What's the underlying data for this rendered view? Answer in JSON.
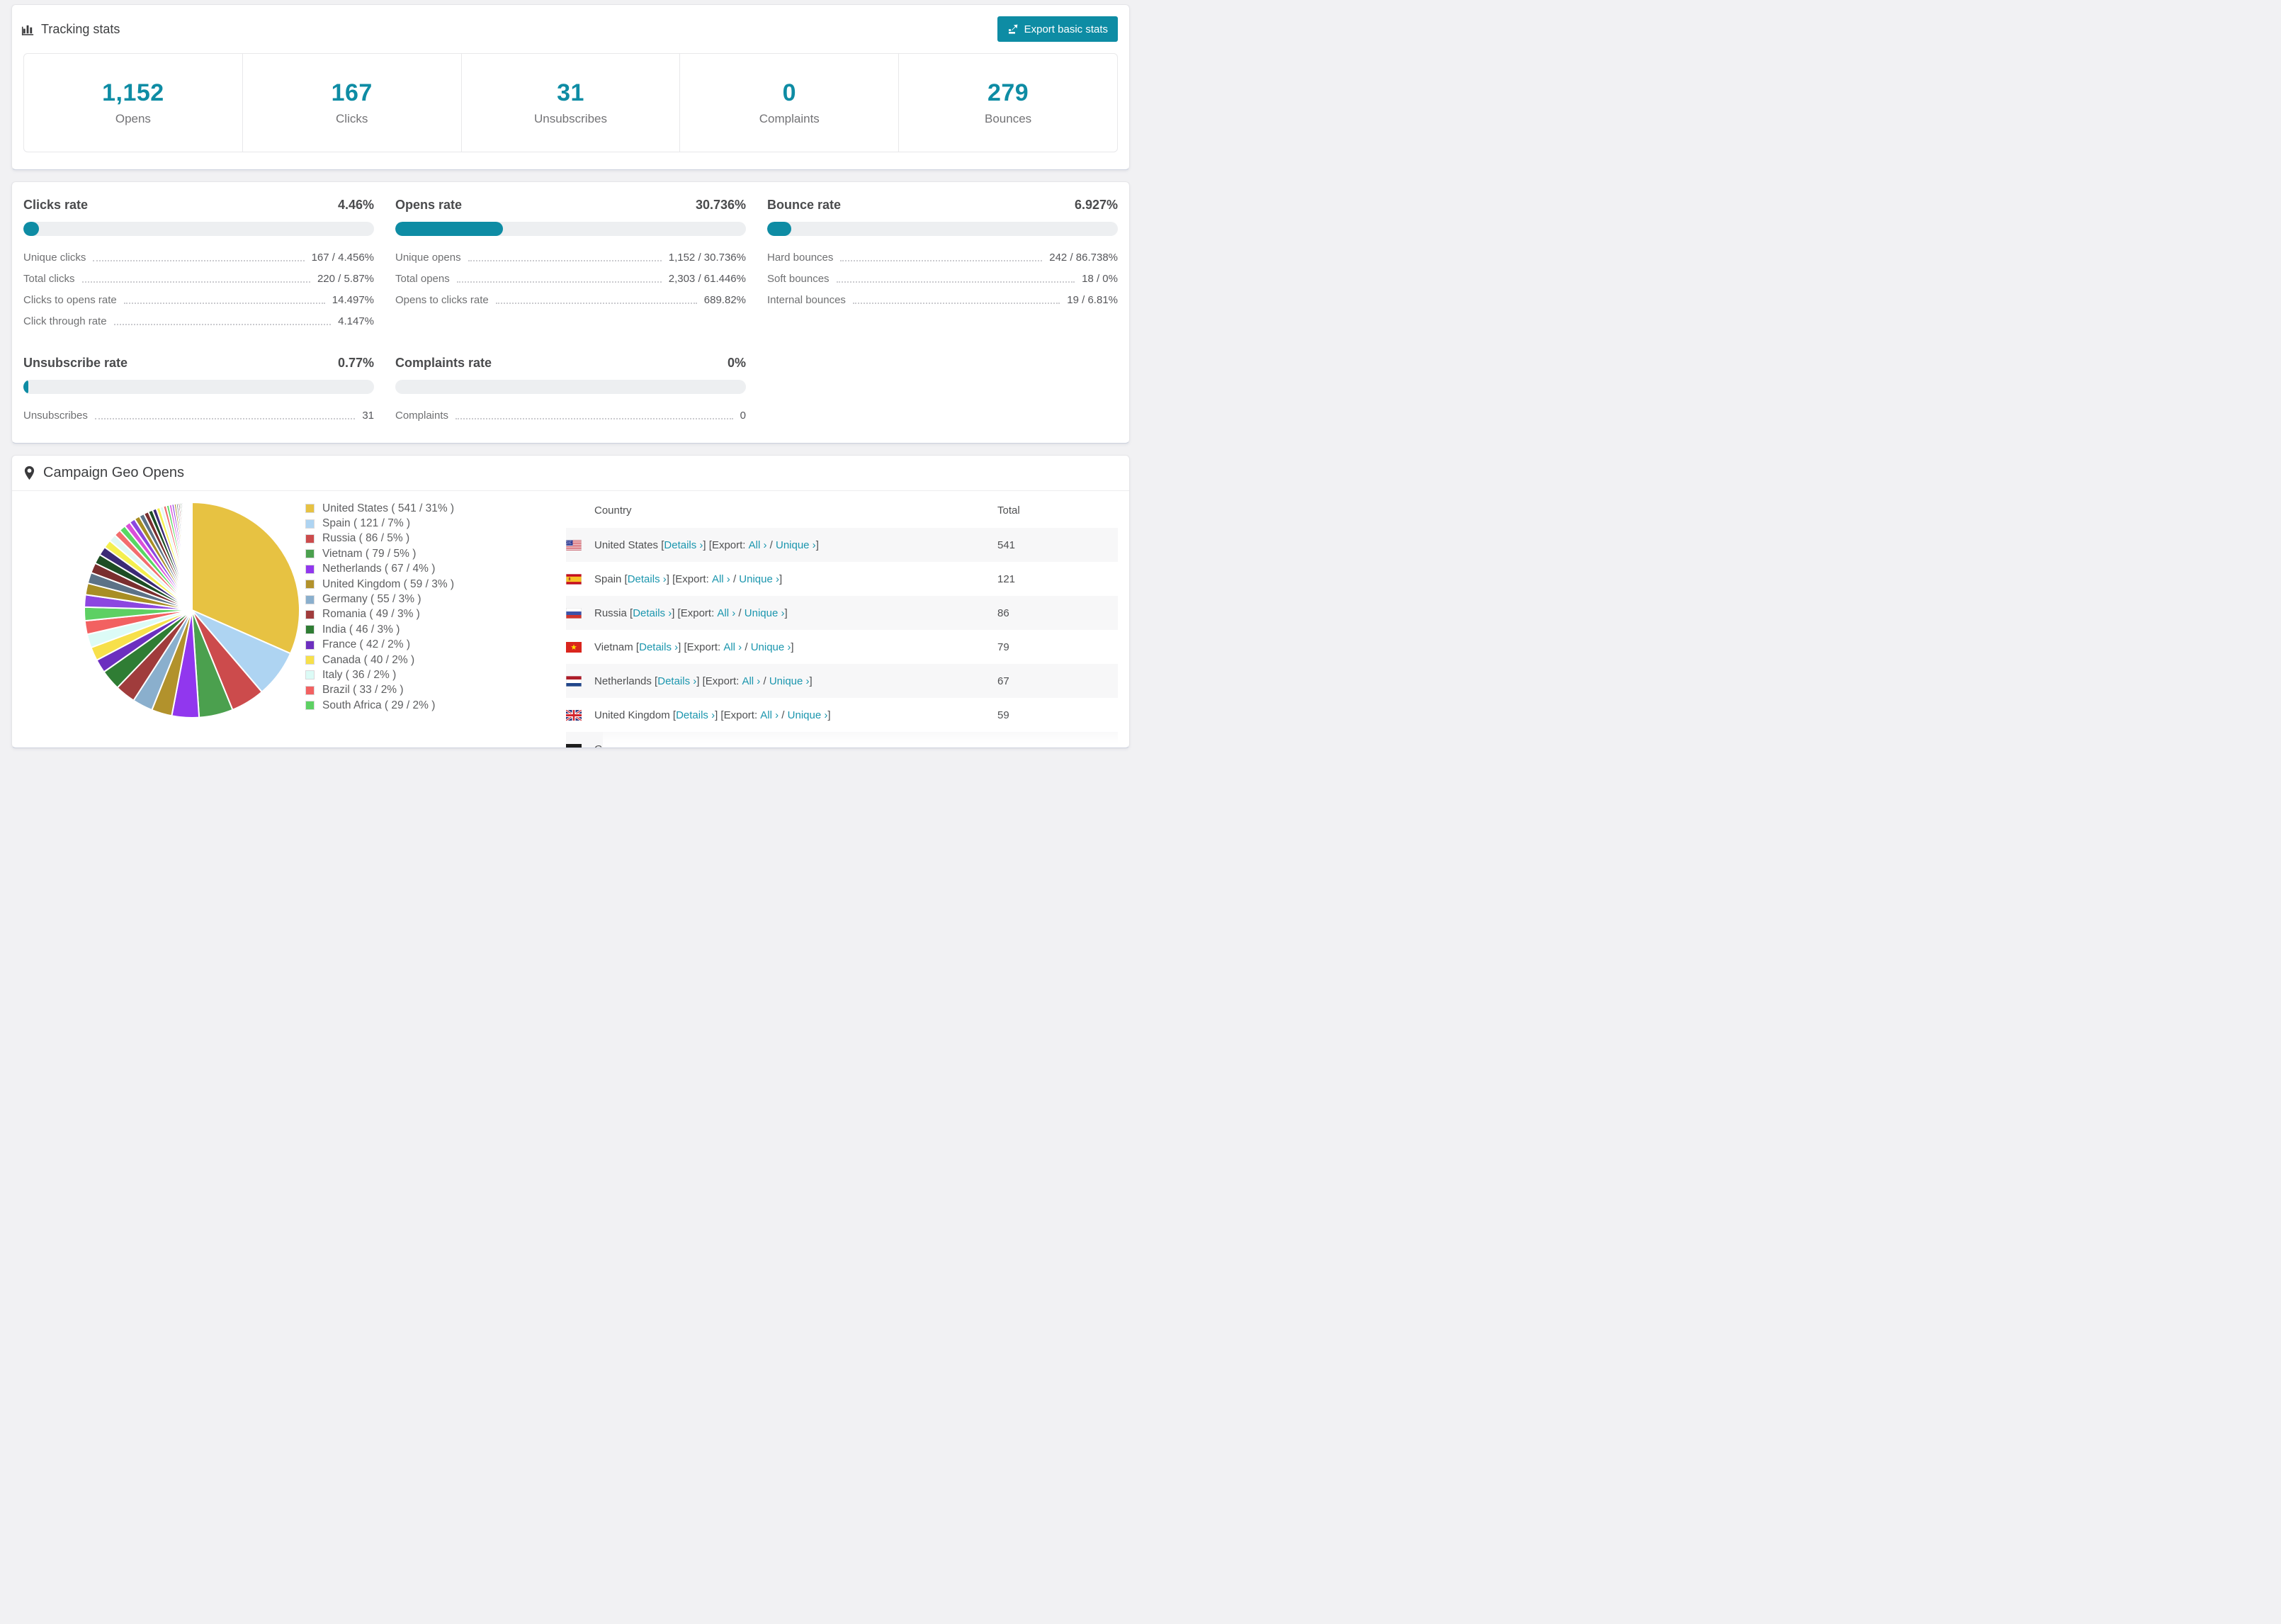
{
  "colors": {
    "accent": "#0e8ca4",
    "link": "#1b96ae",
    "bar_track": "#edeff1"
  },
  "header": {
    "title": "Tracking stats",
    "export_label": "Export basic stats"
  },
  "summary": [
    {
      "value": "1,152",
      "label": "Opens"
    },
    {
      "value": "167",
      "label": "Clicks"
    },
    {
      "value": "31",
      "label": "Unsubscribes"
    },
    {
      "value": "0",
      "label": "Complaints"
    },
    {
      "value": "279",
      "label": "Bounces"
    }
  ],
  "rates": [
    {
      "title": "Clicks rate",
      "value": "4.46%",
      "percent": 4.46,
      "rows": [
        {
          "label": "Unique clicks",
          "value": "167 / 4.456%"
        },
        {
          "label": "Total clicks",
          "value": "220 / 5.87%"
        },
        {
          "label": "Clicks to opens rate",
          "value": "14.497%"
        },
        {
          "label": "Click through rate",
          "value": "4.147%"
        }
      ]
    },
    {
      "title": "Opens rate",
      "value": "30.736%",
      "percent": 30.736,
      "rows": [
        {
          "label": "Unique opens",
          "value": "1,152 / 30.736%"
        },
        {
          "label": "Total opens",
          "value": "2,303 / 61.446%"
        },
        {
          "label": "Opens to clicks rate",
          "value": "689.82%"
        }
      ]
    },
    {
      "title": "Bounce rate",
      "value": "6.927%",
      "percent": 6.927,
      "rows": [
        {
          "label": "Hard bounces",
          "value": "242 / 86.738%"
        },
        {
          "label": "Soft bounces",
          "value": "18 / 0%"
        },
        {
          "label": "Internal bounces",
          "value": "19 / 6.81%"
        }
      ]
    },
    {
      "title": "Unsubscribe rate",
      "value": "0.77%",
      "percent": 0.77,
      "rows": [
        {
          "label": "Unsubscribes",
          "value": "31"
        }
      ]
    },
    {
      "title": "Complaints rate",
      "value": "0%",
      "percent": 0,
      "rows": [
        {
          "label": "Complaints",
          "value": "0"
        }
      ]
    }
  ],
  "geo": {
    "title": "Campaign Geo Opens",
    "chart_data": {
      "type": "pie",
      "title": "Campaign Geo Opens",
      "rotation": "clockwise-from-top",
      "legend_position": "right",
      "series": [
        {
          "name": "United States",
          "value": 541,
          "pct": 31,
          "color": "#e7c242"
        },
        {
          "name": "Spain",
          "value": 121,
          "pct": 7,
          "color": "#aed4f2"
        },
        {
          "name": "Russia",
          "value": 86,
          "pct": 5,
          "color": "#cc4b4c"
        },
        {
          "name": "Vietnam",
          "value": 79,
          "pct": 5,
          "color": "#4ba04e"
        },
        {
          "name": "Netherlands",
          "value": 67,
          "pct": 4,
          "color": "#9137ee"
        },
        {
          "name": "United Kingdom",
          "value": 59,
          "pct": 3,
          "color": "#b2922c"
        },
        {
          "name": "Germany",
          "value": 55,
          "pct": 3,
          "color": "#8aafcd"
        },
        {
          "name": "Romania",
          "value": 49,
          "pct": 3,
          "color": "#a03c3c"
        },
        {
          "name": "India",
          "value": 46,
          "pct": 3,
          "color": "#2f7d34"
        },
        {
          "name": "France",
          "value": 42,
          "pct": 2,
          "color": "#6c2fbf"
        },
        {
          "name": "Canada",
          "value": 40,
          "pct": 2,
          "color": "#f7e04a"
        },
        {
          "name": "Italy",
          "value": 36,
          "pct": 2,
          "color": "#dcfbf6"
        },
        {
          "name": "Brazil",
          "value": 33,
          "pct": 2,
          "color": "#f26161"
        },
        {
          "name": "South Africa",
          "value": 29,
          "pct": 2,
          "color": "#5dd063"
        }
      ],
      "other_slices_pct": [
        1.8,
        1.7,
        1.6,
        1.5,
        1.4,
        1.3,
        1.2,
        1.1,
        1.0,
        0.95,
        0.9,
        0.85,
        0.8,
        0.75,
        0.7,
        0.65,
        0.6,
        0.55,
        0.5,
        0.46,
        0.42,
        0.38,
        0.35,
        0.32,
        0.29,
        0.26,
        0.24,
        0.22,
        0.2,
        0.18,
        0.16,
        0.14,
        0.12,
        0.1,
        0.09,
        0.08,
        0.07,
        0.06,
        0.05,
        0.04
      ],
      "other_colors": [
        "#8c46e0",
        "#a88e24",
        "#5c7287",
        "#7a2e2e",
        "#1d4d24",
        "#3b2a75",
        "#f4ef4e",
        "#e0f7f4",
        "#f26d6d",
        "#58d863",
        "#d94fd9"
      ]
    },
    "table": {
      "columns": [
        "Country",
        "Total"
      ],
      "details_label": "Details ›",
      "export_prefix": "Export:",
      "all_label": "All ›",
      "unique_label": "Unique ›",
      "rows": [
        {
          "country": "United States",
          "flag": "us",
          "total": "541"
        },
        {
          "country": "Spain",
          "flag": "es",
          "total": "121"
        },
        {
          "country": "Russia",
          "flag": "ru",
          "total": "86"
        },
        {
          "country": "Vietnam",
          "flag": "vn",
          "total": "79"
        },
        {
          "country": "Netherlands",
          "flag": "nl",
          "total": "67"
        },
        {
          "country": "United Kingdom",
          "flag": "gb",
          "total": "59"
        },
        {
          "country": "Germany",
          "flag": "de",
          "total": ""
        }
      ]
    }
  }
}
